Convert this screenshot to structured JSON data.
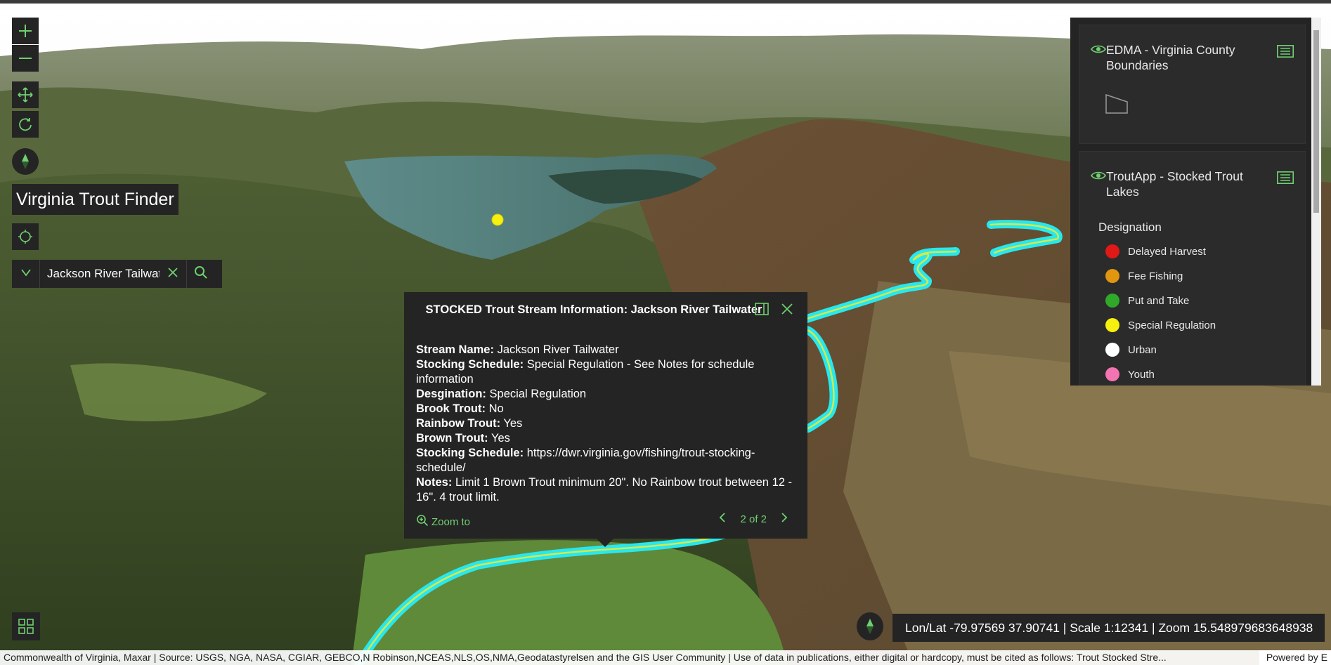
{
  "app": {
    "title": "Virginia Trout Finder"
  },
  "search": {
    "value": "Jackson River Tailwater",
    "placeholder": ""
  },
  "legend": {
    "layer1": {
      "title": "EDMA - Virginia County Boundaries"
    },
    "layer2": {
      "title": "TroutApp - Stocked Trout Lakes",
      "field": "Designation",
      "items": [
        {
          "label": "Delayed Harvest",
          "color": "#e01818"
        },
        {
          "label": "Fee Fishing",
          "color": "#e0960e"
        },
        {
          "label": "Put and Take",
          "color": "#30a82a"
        },
        {
          "label": "Special Regulation",
          "color": "#f5f010"
        },
        {
          "label": "Urban",
          "color": "#ffffff"
        },
        {
          "label": "Youth",
          "color": "#f274b0"
        }
      ]
    }
  },
  "popup": {
    "title": "STOCKED Trout Stream Information: Jackson River Tailwater",
    "fields": [
      {
        "label": "Stream Name:",
        "value": "Jackson River Tailwater"
      },
      {
        "label": "Stocking Schedule:",
        "value": "Special Regulation - See Notes for schedule information"
      },
      {
        "label": "Desgination:",
        "value": "Special Regulation"
      },
      {
        "label": "Brook Trout:",
        "value": "No"
      },
      {
        "label": "Rainbow Trout:",
        "value": "Yes"
      },
      {
        "label": "Brown Trout:",
        "value": "Yes"
      },
      {
        "label": "Stocking Schedule:",
        "value": "https://dwr.virginia.gov/fishing/trout-stocking-schedule/"
      },
      {
        "label": "Notes:",
        "value": "Limit 1 Brown Trout minimum 20\". No Rainbow trout between 12 - 16\". 4 trout limit."
      }
    ],
    "zoom_label": "Zoom to",
    "pager": "2 of 2"
  },
  "status": {
    "coords": "Lon/Lat -79.97569 37.90741 | Scale 1:12341 | Zoom 15.548979683648938",
    "attribution": "Commonwealth of Virginia, Maxar | Source: USGS, NGA, NASA, CGIAR, GEBCO,N Robinson,NCEAS,NLS,OS,NMA,Geodatastyrelsen and the GIS User Community | Use of data in publications, either digital or hardcopy, must be cited as follows: Trout Stocked Stre...",
    "powered_by": "Powered by E"
  },
  "icons": {
    "zoom_in": "plus-icon",
    "zoom_out": "minus-icon",
    "pan": "pan-arrows-icon",
    "rotate": "rotate-icon",
    "compass": "compass-icon",
    "locate": "locate-crosshair-icon",
    "basemap": "basemap-toggle-icon",
    "visibility": "eye-icon",
    "layer_menu": "list-menu-icon",
    "dock": "dock-panel-icon",
    "close": "close-icon",
    "search": "search-icon",
    "clear": "clear-x-icon",
    "dropdown": "chevron-down-icon"
  },
  "colors": {
    "accent": "#6fd06f",
    "panel": "#242424",
    "stream": "#27e8ee",
    "stream_core": "#d6e84a"
  }
}
